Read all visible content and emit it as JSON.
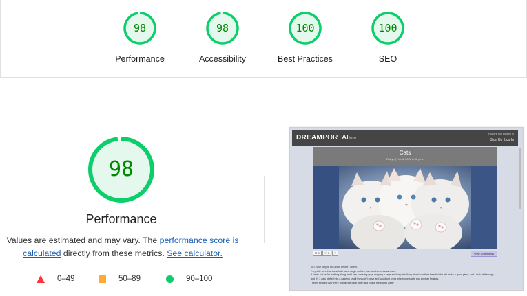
{
  "summary": [
    {
      "score": "98",
      "label": "Performance",
      "fraction": 0.98
    },
    {
      "score": "98",
      "label": "Accessibility",
      "fraction": 0.98
    },
    {
      "score": "100",
      "label": "Best Practices",
      "fraction": 1.0
    },
    {
      "score": "100",
      "label": "SEO",
      "fraction": 1.0
    }
  ],
  "main": {
    "score": "98",
    "fraction": 0.98,
    "title": "Performance",
    "desc_prefix": "Values are estimated and may vary. The ",
    "link_score": "performance score is calculated",
    "desc_middle": " directly from these metrics. ",
    "link_calc": "See calculator.",
    "legend": [
      {
        "shape": "triangle",
        "range": "0–49",
        "color": "#ff3333"
      },
      {
        "shape": "square",
        "range": "50–89",
        "color": "#ffaa33"
      },
      {
        "shape": "circle",
        "range": "90–100",
        "color": "#0cce6b"
      }
    ]
  },
  "screenshot": {
    "brand_bold": "DREAM",
    "brand_light": "PORTAL",
    "nav_home": "Home",
    "logged_in": "You are not logged in",
    "sign_up": "Sign Up",
    "log_in": "Log In",
    "post_title": "Cats",
    "post_meta": "Robyn | Feb 4, 2026 8:00 p.m.",
    "comment_count": "0",
    "like_count": "0",
    "view_comments": "View Comments",
    "body_lines": [
      "So I have to type this down before I lose it.",
      "I'm pretty sure that some kids have magic so they can turn into a human form.",
      "It starts out as I'm walking along and I see some big guys carrying a cage and they're talking about how their beautiful fur will make a good piece, and I look at the cage",
      "and it's 3 cats stuffed into a cage so small they can't move and you don't know where one starts and another finishes.",
      "I sprint straight over there and tip the cage open and chase the bullies away."
    ]
  },
  "colors": {
    "good": "#0cce6b",
    "good_text": "#008800",
    "good_fill": "#e5f8ed",
    "link": "#1a5fb4"
  }
}
